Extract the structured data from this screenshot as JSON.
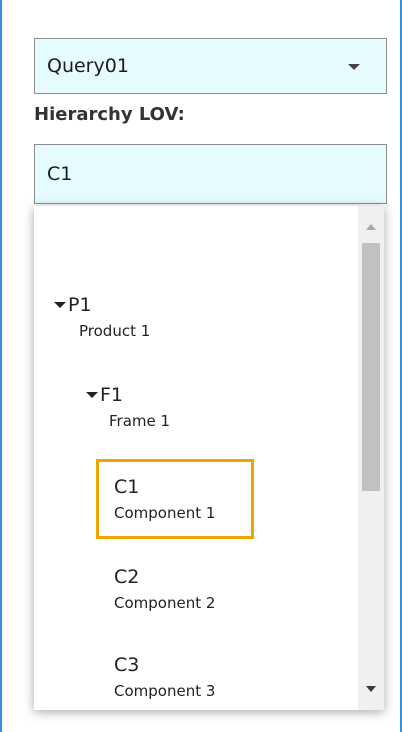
{
  "query_select": {
    "value": "Query01"
  },
  "hierarchy_lov": {
    "label": "Hierarchy LOV:",
    "input_value": "C1"
  },
  "tree": {
    "p1": {
      "code": "P1",
      "desc": "Product 1"
    },
    "f1": {
      "code": "F1",
      "desc": "Frame 1"
    },
    "c1": {
      "code": "C1",
      "desc": "Component 1"
    },
    "c2": {
      "code": "C2",
      "desc": "Component 2"
    },
    "c3": {
      "code": "C3",
      "desc": "Component 3"
    }
  },
  "colors": {
    "input_bg": "#e6fbff",
    "selection_outline": "#f0a500",
    "window_border": "#3b8fd6"
  }
}
